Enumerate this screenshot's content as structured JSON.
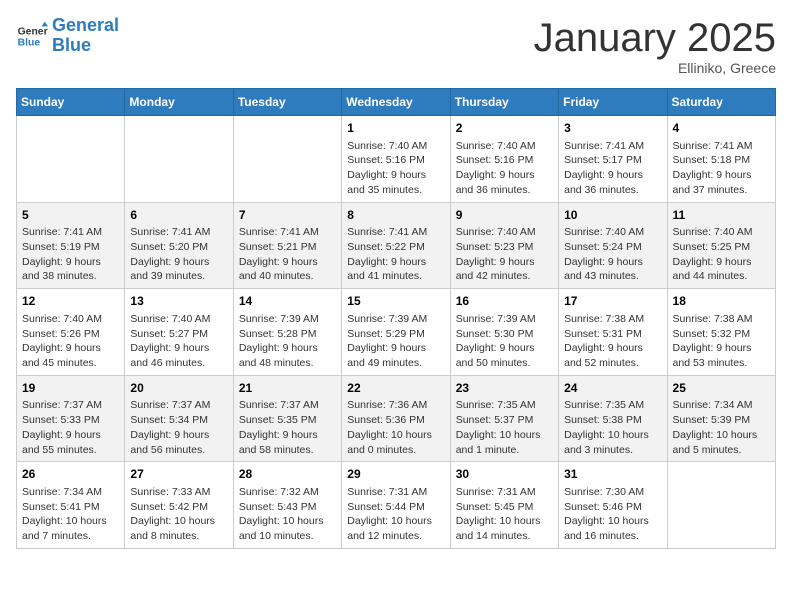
{
  "header": {
    "logo_line1": "General",
    "logo_line2": "Blue",
    "month": "January 2025",
    "location": "Elliniko, Greece"
  },
  "weekdays": [
    "Sunday",
    "Monday",
    "Tuesday",
    "Wednesday",
    "Thursday",
    "Friday",
    "Saturday"
  ],
  "weeks": [
    [
      {
        "day": "",
        "info": ""
      },
      {
        "day": "",
        "info": ""
      },
      {
        "day": "",
        "info": ""
      },
      {
        "day": "1",
        "info": "Sunrise: 7:40 AM\nSunset: 5:16 PM\nDaylight: 9 hours and 35 minutes."
      },
      {
        "day": "2",
        "info": "Sunrise: 7:40 AM\nSunset: 5:16 PM\nDaylight: 9 hours and 36 minutes."
      },
      {
        "day": "3",
        "info": "Sunrise: 7:41 AM\nSunset: 5:17 PM\nDaylight: 9 hours and 36 minutes."
      },
      {
        "day": "4",
        "info": "Sunrise: 7:41 AM\nSunset: 5:18 PM\nDaylight: 9 hours and 37 minutes."
      }
    ],
    [
      {
        "day": "5",
        "info": "Sunrise: 7:41 AM\nSunset: 5:19 PM\nDaylight: 9 hours and 38 minutes."
      },
      {
        "day": "6",
        "info": "Sunrise: 7:41 AM\nSunset: 5:20 PM\nDaylight: 9 hours and 39 minutes."
      },
      {
        "day": "7",
        "info": "Sunrise: 7:41 AM\nSunset: 5:21 PM\nDaylight: 9 hours and 40 minutes."
      },
      {
        "day": "8",
        "info": "Sunrise: 7:41 AM\nSunset: 5:22 PM\nDaylight: 9 hours and 41 minutes."
      },
      {
        "day": "9",
        "info": "Sunrise: 7:40 AM\nSunset: 5:23 PM\nDaylight: 9 hours and 42 minutes."
      },
      {
        "day": "10",
        "info": "Sunrise: 7:40 AM\nSunset: 5:24 PM\nDaylight: 9 hours and 43 minutes."
      },
      {
        "day": "11",
        "info": "Sunrise: 7:40 AM\nSunset: 5:25 PM\nDaylight: 9 hours and 44 minutes."
      }
    ],
    [
      {
        "day": "12",
        "info": "Sunrise: 7:40 AM\nSunset: 5:26 PM\nDaylight: 9 hours and 45 minutes."
      },
      {
        "day": "13",
        "info": "Sunrise: 7:40 AM\nSunset: 5:27 PM\nDaylight: 9 hours and 46 minutes."
      },
      {
        "day": "14",
        "info": "Sunrise: 7:39 AM\nSunset: 5:28 PM\nDaylight: 9 hours and 48 minutes."
      },
      {
        "day": "15",
        "info": "Sunrise: 7:39 AM\nSunset: 5:29 PM\nDaylight: 9 hours and 49 minutes."
      },
      {
        "day": "16",
        "info": "Sunrise: 7:39 AM\nSunset: 5:30 PM\nDaylight: 9 hours and 50 minutes."
      },
      {
        "day": "17",
        "info": "Sunrise: 7:38 AM\nSunset: 5:31 PM\nDaylight: 9 hours and 52 minutes."
      },
      {
        "day": "18",
        "info": "Sunrise: 7:38 AM\nSunset: 5:32 PM\nDaylight: 9 hours and 53 minutes."
      }
    ],
    [
      {
        "day": "19",
        "info": "Sunrise: 7:37 AM\nSunset: 5:33 PM\nDaylight: 9 hours and 55 minutes."
      },
      {
        "day": "20",
        "info": "Sunrise: 7:37 AM\nSunset: 5:34 PM\nDaylight: 9 hours and 56 minutes."
      },
      {
        "day": "21",
        "info": "Sunrise: 7:37 AM\nSunset: 5:35 PM\nDaylight: 9 hours and 58 minutes."
      },
      {
        "day": "22",
        "info": "Sunrise: 7:36 AM\nSunset: 5:36 PM\nDaylight: 10 hours and 0 minutes."
      },
      {
        "day": "23",
        "info": "Sunrise: 7:35 AM\nSunset: 5:37 PM\nDaylight: 10 hours and 1 minute."
      },
      {
        "day": "24",
        "info": "Sunrise: 7:35 AM\nSunset: 5:38 PM\nDaylight: 10 hours and 3 minutes."
      },
      {
        "day": "25",
        "info": "Sunrise: 7:34 AM\nSunset: 5:39 PM\nDaylight: 10 hours and 5 minutes."
      }
    ],
    [
      {
        "day": "26",
        "info": "Sunrise: 7:34 AM\nSunset: 5:41 PM\nDaylight: 10 hours and 7 minutes."
      },
      {
        "day": "27",
        "info": "Sunrise: 7:33 AM\nSunset: 5:42 PM\nDaylight: 10 hours and 8 minutes."
      },
      {
        "day": "28",
        "info": "Sunrise: 7:32 AM\nSunset: 5:43 PM\nDaylight: 10 hours and 10 minutes."
      },
      {
        "day": "29",
        "info": "Sunrise: 7:31 AM\nSunset: 5:44 PM\nDaylight: 10 hours and 12 minutes."
      },
      {
        "day": "30",
        "info": "Sunrise: 7:31 AM\nSunset: 5:45 PM\nDaylight: 10 hours and 14 minutes."
      },
      {
        "day": "31",
        "info": "Sunrise: 7:30 AM\nSunset: 5:46 PM\nDaylight: 10 hours and 16 minutes."
      },
      {
        "day": "",
        "info": ""
      }
    ]
  ]
}
